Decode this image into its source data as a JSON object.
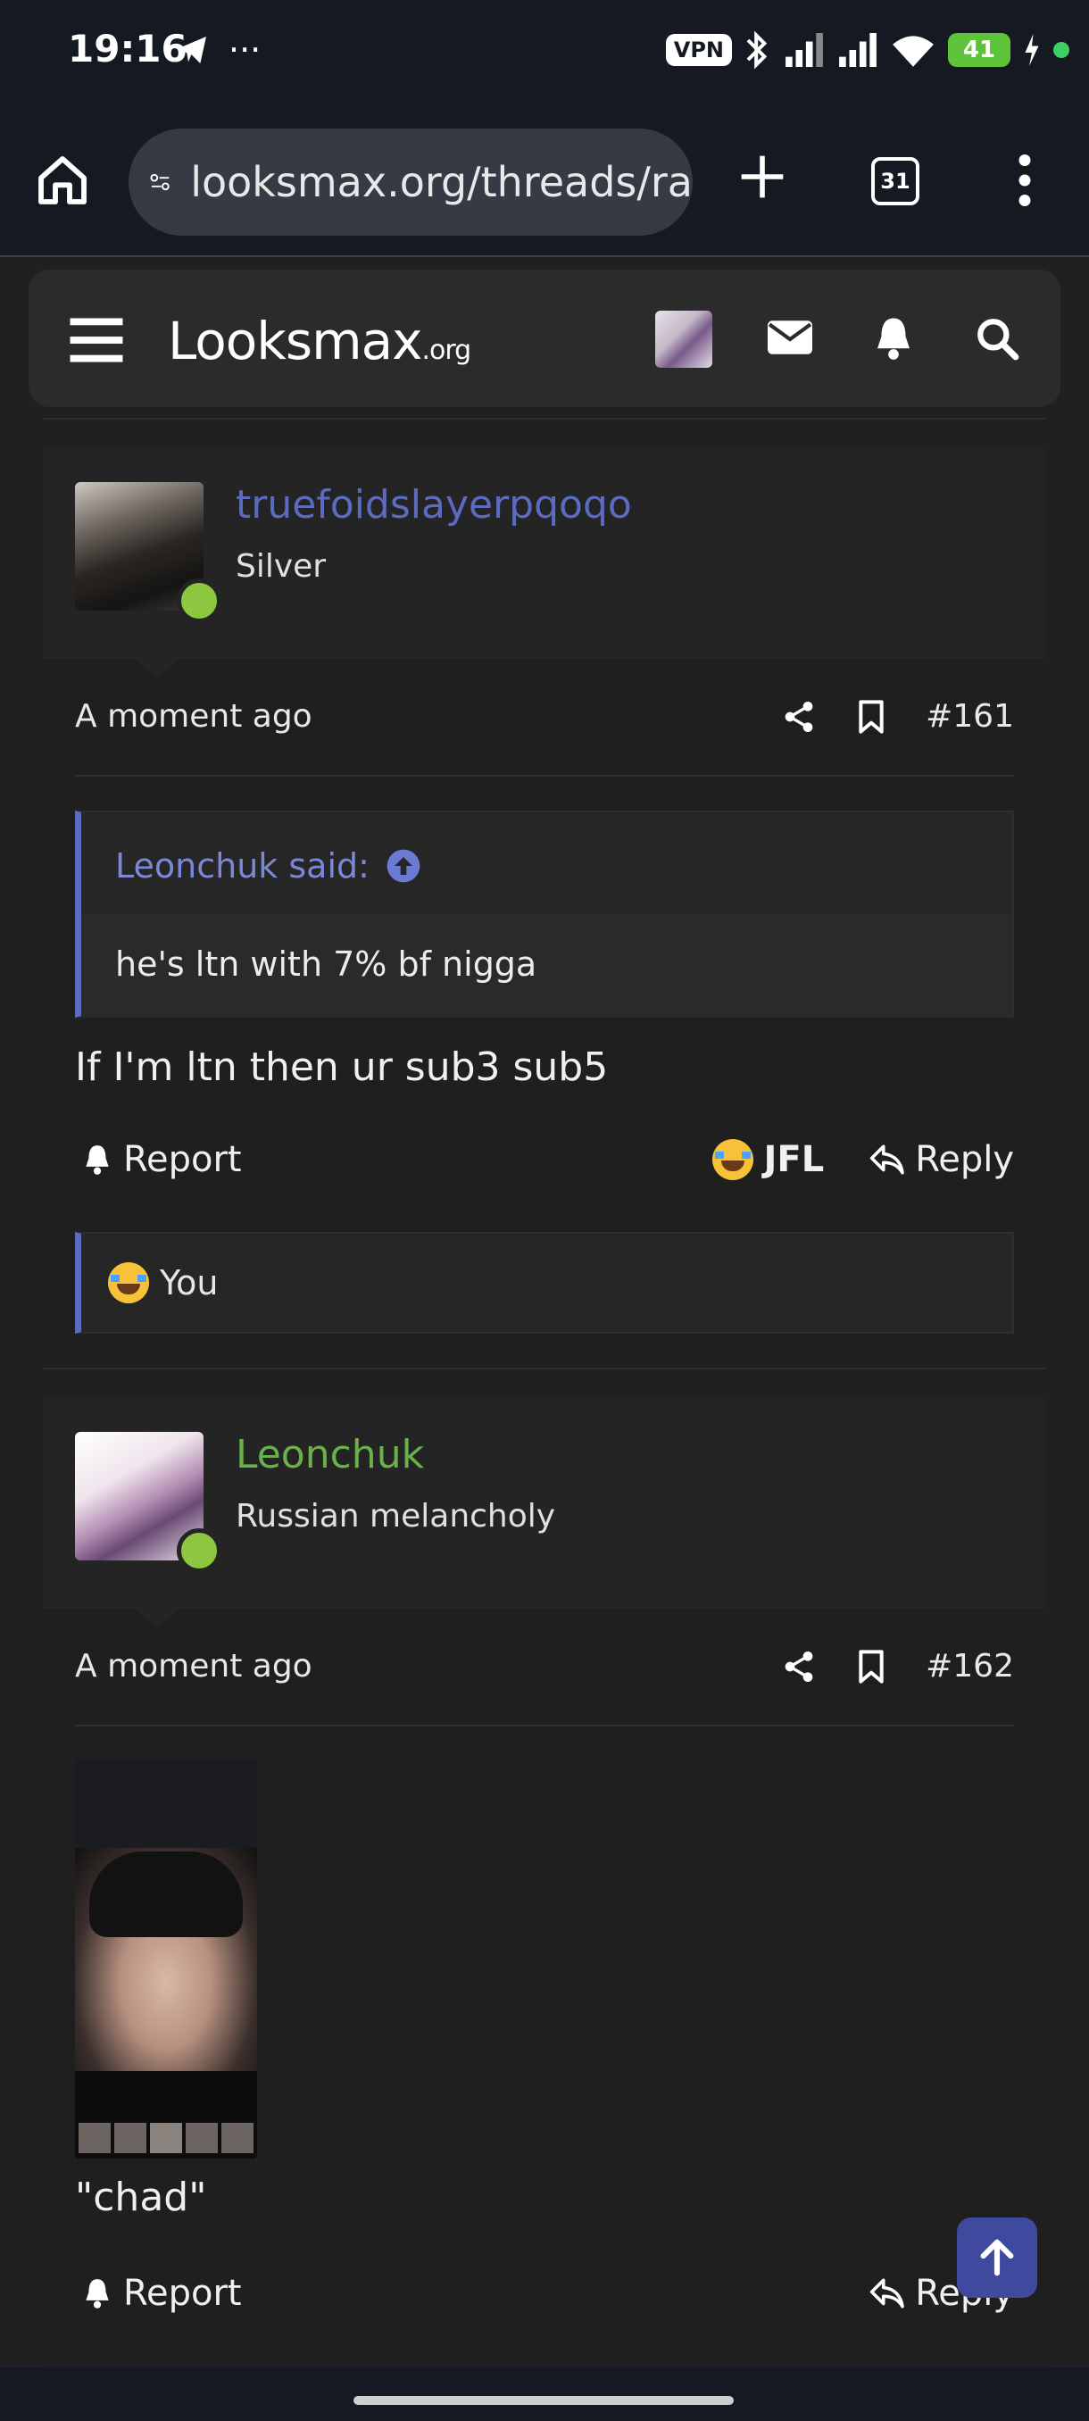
{
  "status_bar": {
    "time": "19:16",
    "vpn_label": "VPN",
    "battery": "41"
  },
  "browser": {
    "url": "looksmax.org/threads/ra",
    "tab_count": "31"
  },
  "site": {
    "logo_main": "Looksmax",
    "logo_suffix": ".org"
  },
  "posts": [
    {
      "username": "truefoidslayerpqoqo",
      "username_color": "#5c6bc0",
      "user_title": "Silver",
      "time": "A moment ago",
      "post_number": "#161",
      "quote": {
        "author": "Leonchuk said:",
        "text": "he's ltn with 7% bf nigga"
      },
      "text": "If I'm ltn then ur sub3 sub5",
      "actions": {
        "report": "Report",
        "reaction": "JFL",
        "reply": "Reply"
      },
      "reactions_summary": "You"
    },
    {
      "username": "Leonchuk",
      "username_color": "#6ab04c",
      "user_title": "Russian melancholy",
      "time": "A moment ago",
      "post_number": "#162",
      "text": "\"chad\"",
      "actions": {
        "report": "Report",
        "reply": "Reply"
      }
    }
  ]
}
